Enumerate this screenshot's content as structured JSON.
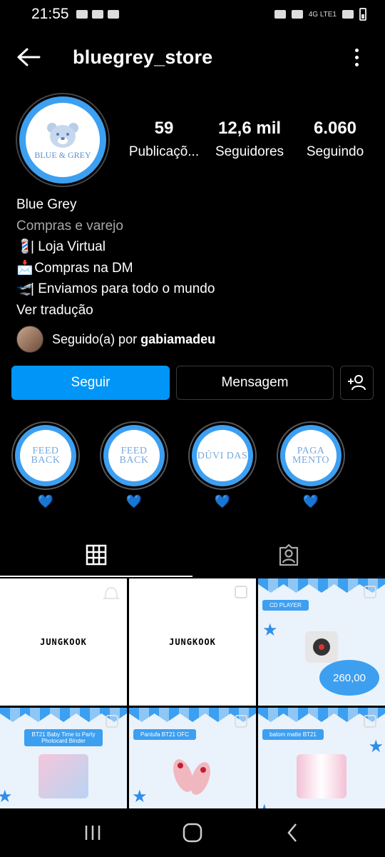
{
  "status_bar": {
    "time": "21:55",
    "network": "4G LTE1"
  },
  "header": {
    "username": "bluegrey_store"
  },
  "profile": {
    "avatar_text": "BLUE & GREY",
    "stats": [
      {
        "value": "59",
        "label": "Publicaçõ..."
      },
      {
        "value": "12,6 mil",
        "label": "Seguidores"
      },
      {
        "value": "6.060",
        "label": "Seguindo"
      }
    ],
    "name": "Blue Grey",
    "category": "Compras e varejo",
    "bio_lines": [
      {
        "emoji": "💈",
        "text": "| Loja Virtual"
      },
      {
        "emoji": "📩",
        "text": "Compras na DM"
      },
      {
        "emoji": "🛫",
        "text": "| Enviamos para todo o mundo"
      }
    ],
    "translate": "Ver tradução",
    "followed_prefix": "Seguido(a) por ",
    "followed_by": "gabiamadeu"
  },
  "actions": {
    "follow": "Seguir",
    "message": "Mensagem"
  },
  "highlights": [
    {
      "cover": "FEED BACK",
      "label": "💙"
    },
    {
      "cover": "FEED BACK",
      "label": "💙"
    },
    {
      "cover": "DÚVI DAS",
      "label": "💙"
    },
    {
      "cover": "PAGA MENTO",
      "label": "💙"
    }
  ],
  "grid": [
    {
      "kind": "text",
      "text": "JUNGKOOK"
    },
    {
      "kind": "text",
      "text": "JUNGKOOK"
    },
    {
      "kind": "product",
      "tag": "CD PLAYER",
      "price": "260,00"
    },
    {
      "kind": "product",
      "tag": "BT21 Baby Time to Party Photocard Binder"
    },
    {
      "kind": "product",
      "tag": "Pantufa BT21 OFC"
    },
    {
      "kind": "product",
      "tag": "batom matte BT21"
    }
  ],
  "colors": {
    "accent": "#0095f6",
    "brand_blue": "#3d9ff0",
    "background": "#000000"
  }
}
